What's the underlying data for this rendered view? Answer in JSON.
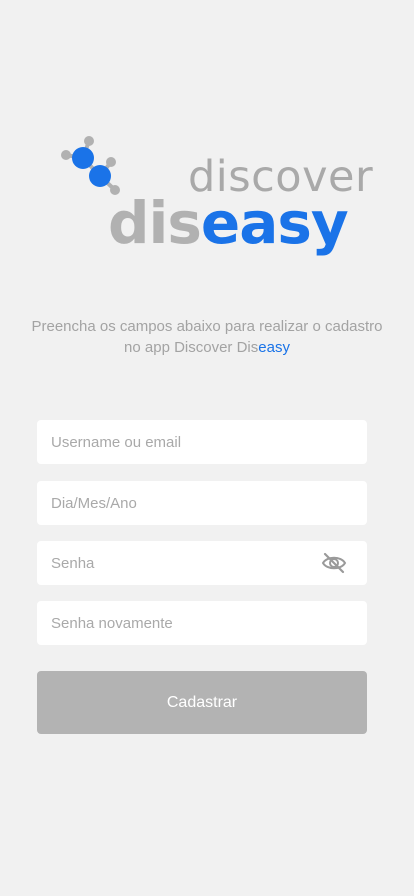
{
  "logo": {
    "word_top": "discover",
    "word_bottom_gray": "dis",
    "word_bottom_blue": "easy"
  },
  "subtitle": {
    "line_prefix": "Preencha os campos abaixo para realizar o cadastro no app Discover Dis",
    "highlight": "easy"
  },
  "form": {
    "username_placeholder": "Username ou email",
    "date_placeholder": "Dia/Mes/Ano",
    "password_placeholder": "Senha",
    "password_repeat_placeholder": "Senha novamente",
    "submit_label": "Cadastrar"
  },
  "colors": {
    "background": "#f1f1f1",
    "brand_blue": "#1a73e8",
    "gray_text": "#a3a3a3",
    "button_disabled": "#b3b3b3"
  },
  "icons": {
    "logo_mark": "molecule-icon",
    "password_toggle": "eye-slash-icon"
  }
}
